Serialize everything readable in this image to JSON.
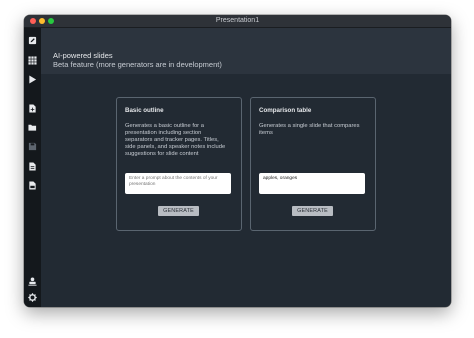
{
  "window": {
    "title": "Presentation1"
  },
  "sidebar": {
    "items": [
      {
        "icon": "pencil-edit-icon"
      },
      {
        "icon": "grid-icon"
      },
      {
        "icon": "play-icon"
      },
      {
        "icon": "new-document-icon"
      },
      {
        "icon": "folder-open-icon"
      },
      {
        "icon": "save-icon"
      },
      {
        "icon": "export-document-icon"
      },
      {
        "icon": "pdf-document-icon"
      }
    ],
    "bottom_items": [
      {
        "icon": "presenter-icon"
      },
      {
        "icon": "gear-icon"
      },
      {
        "icon": "help-icon"
      }
    ]
  },
  "header": {
    "title": "AI-powered slides",
    "subtitle": "Beta feature (more generators are in development)"
  },
  "cards": [
    {
      "title": "Basic outline",
      "description": "Generates a basic outline for a presentation including section separators and tracker pages. Titles, side panels, and speaker notes include suggestions for slide content",
      "input_value": "",
      "input_placeholder": "Enter a prompt about the contents of your presentation",
      "button_label": "GENERATE"
    },
    {
      "title": "Comparison table",
      "description": "Generates a single slide that compares items",
      "input_value": "apples, oranges",
      "input_placeholder": "",
      "button_label": "GENERATE"
    }
  ],
  "colors": {
    "background": "#222a33",
    "header": "#2c343e",
    "sidebar": "#14181c",
    "button": "#b8bcc2"
  }
}
